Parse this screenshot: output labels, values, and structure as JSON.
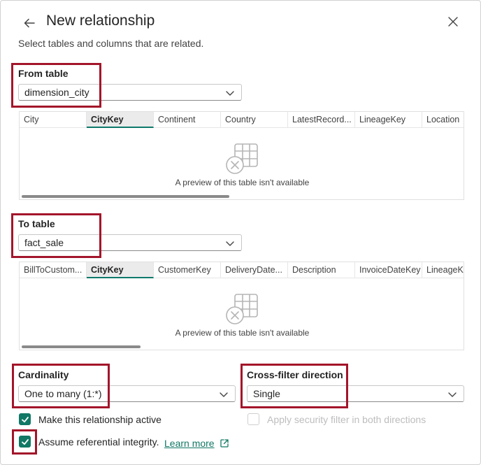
{
  "dialog": {
    "title": "New relationship",
    "subtitle": "Select tables and columns that are related."
  },
  "from": {
    "label": "From table",
    "selected": "dimension_city",
    "columns": [
      "City",
      "CityKey",
      "Continent",
      "Country",
      "LatestRecord...",
      "LineageKey",
      "Location"
    ],
    "active_column": "CityKey",
    "empty_text": "A preview of this table isn't available",
    "scroll_fraction": 0.47
  },
  "to": {
    "label": "To table",
    "selected": "fact_sale",
    "columns": [
      "BillToCustom...",
      "CityKey",
      "CustomerKey",
      "DeliveryDate...",
      "Description",
      "InvoiceDateKey",
      "LineageKe"
    ],
    "active_column": "CityKey",
    "empty_text": "A preview of this table isn't available",
    "scroll_fraction": 0.27
  },
  "cardinality": {
    "label": "Cardinality",
    "selected": "One to many (1:*)"
  },
  "crossfilter": {
    "label": "Cross-filter direction",
    "selected": "Single"
  },
  "options": {
    "active_label": "Make this relationship active",
    "active_checked": true,
    "security_label": "Apply security filter in both directions",
    "security_checked": false,
    "security_disabled": true,
    "integrity_label": "Assume referential integrity.",
    "integrity_checked": true,
    "learn_more": "Learn more"
  },
  "colors": {
    "accent": "#117865",
    "highlight": "#a3152a"
  }
}
